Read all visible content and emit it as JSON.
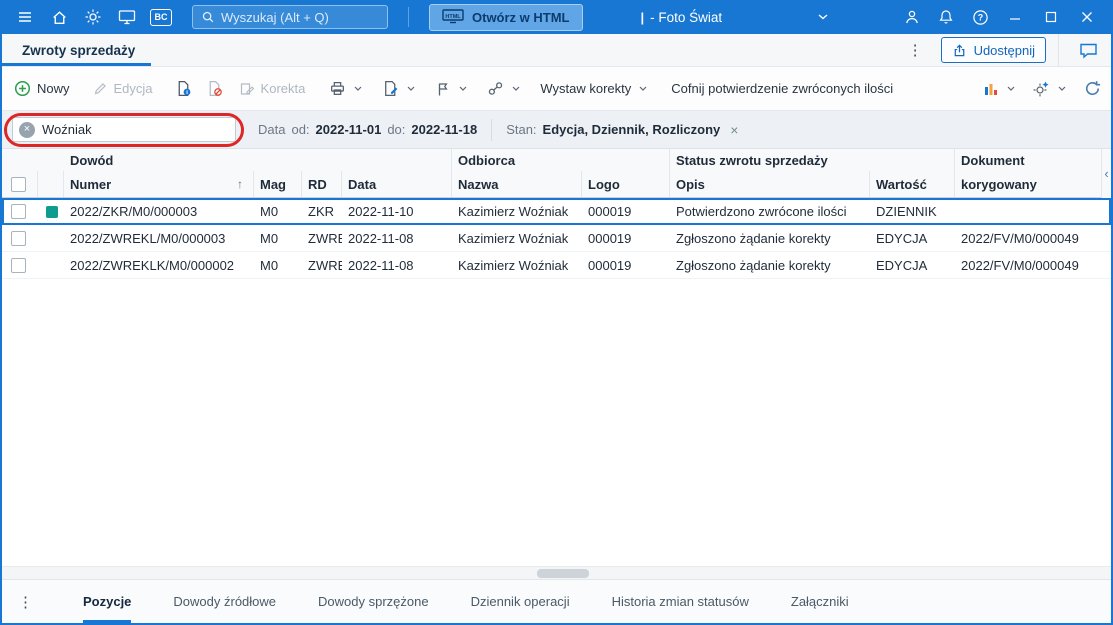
{
  "titlebar": {
    "search_placeholder": "Wyszukaj (Alt + Q)",
    "open_html_label": "Otwórz w HTML",
    "caret": "|",
    "window_title": "- Foto Świat",
    "bc_label": "BC"
  },
  "tabbar": {
    "active_tab": "Zwroty sprzedaży",
    "menu_glyph": "⋮",
    "share_label": "Udostępnij"
  },
  "toolbar": {
    "new_label": "Nowy",
    "edit_label": "Edycja",
    "correction_label": "Korekta",
    "issue_corrections_label": "Wystaw korekty",
    "undo_confirmation_label": "Cofnij potwierdzenie zwróconych ilości"
  },
  "filterbar": {
    "search_value": "Woźniak",
    "clear_glyph": "×",
    "date_label": "Data",
    "from_label": "od:",
    "date_from": "2022-11-01",
    "to_label": "do:",
    "date_to": "2022-11-18",
    "state_label": "Stan:",
    "state_value": "Edycja, Dziennik, Rozliczony",
    "remove_glyph": "×"
  },
  "table": {
    "sort_glyph": "↑",
    "collapse_glyph": "‹",
    "groups": {
      "dowod": "Dowód",
      "odbiorca": "Odbiorca",
      "status": "Status zwrotu sprzedaży",
      "dokument": "Dokument"
    },
    "columns": {
      "numer": "Numer",
      "mag": "Mag",
      "rd": "RD",
      "data": "Data",
      "nazwa": "Nazwa",
      "logo": "Logo",
      "opis": "Opis",
      "wartosc": "Wartość",
      "korygowany": "korygowany"
    },
    "rows": [
      {
        "numer": "2022/ZKR/M0/000003",
        "mag": "M0",
        "rd": "ZKR",
        "data": "2022-11-10",
        "nazwa": "Kazimierz Woźniak",
        "logo": "000019",
        "opis": "Potwierdzono zwrócone ilości",
        "wartosc": "DZIENNIK",
        "dokument": ""
      },
      {
        "numer": "2022/ZWREKL/M0/000003",
        "mag": "M0",
        "rd": "ZWREKL",
        "data": "2022-11-08",
        "nazwa": "Kazimierz Woźniak",
        "logo": "000019",
        "opis": "Zgłoszono żądanie korekty",
        "wartosc": "EDYCJA",
        "dokument": "2022/FV/M0/000049"
      },
      {
        "numer": "2022/ZWREKLK/M0/000002",
        "mag": "M0",
        "rd": "ZWREKL",
        "data": "2022-11-08",
        "nazwa": "Kazimierz Woźniak",
        "logo": "000019",
        "opis": "Zgłoszono żądanie korekty",
        "wartosc": "EDYCJA",
        "dokument": "2022/FV/M0/000049"
      }
    ]
  },
  "bottombar": {
    "menu_glyph": "⋮",
    "tabs": [
      "Pozycje",
      "Dowody źródłowe",
      "Dowody sprzężone",
      "Dziennik operacji",
      "Historia zmian statusów",
      "Załączniki"
    ],
    "active_tab": "Pozycje"
  },
  "colors": {
    "accent": "#1777D2",
    "annotation_red": "#DD2626",
    "status_teal": "#0D9C8F",
    "new_green": "#2E9E4F",
    "chart_orange": "#F2A33C",
    "chart_red": "#E04B3A"
  }
}
